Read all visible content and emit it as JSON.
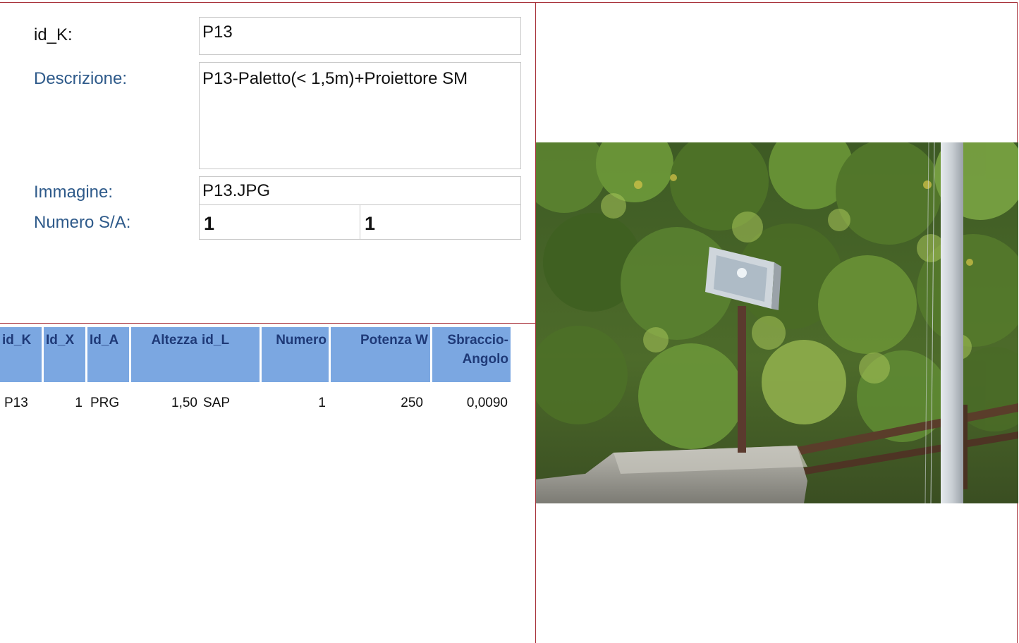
{
  "form": {
    "id_k_label": "id_K:",
    "id_k_value": "P13",
    "descrizione_label": "Descrizione:",
    "descrizione_value": "P13-Paletto(< 1,5m)+Proiettore SM",
    "immagine_label": "Immagine:",
    "immagine_value": "P13.JPG",
    "numero_label": "Numero S/A:",
    "numero_s": "1",
    "numero_a": "1"
  },
  "table": {
    "headers": [
      "id_K",
      "Id_X",
      "Id_A",
      "Altezza",
      "id_L",
      "Numero",
      "Potenza W",
      "Sbraccio-\nAngolo"
    ],
    "rows": [
      [
        "P13",
        "1",
        "PRG",
        "1,50",
        "SAP",
        "1",
        "250",
        "0,0090"
      ]
    ]
  },
  "photo": {
    "colors": {
      "foliage_dark": "#2f4a1c",
      "foliage_light": "#6e9a3a",
      "pole": "#c9cfd4",
      "rail": "#5a3d2a",
      "wall": "#9a9a94"
    }
  }
}
